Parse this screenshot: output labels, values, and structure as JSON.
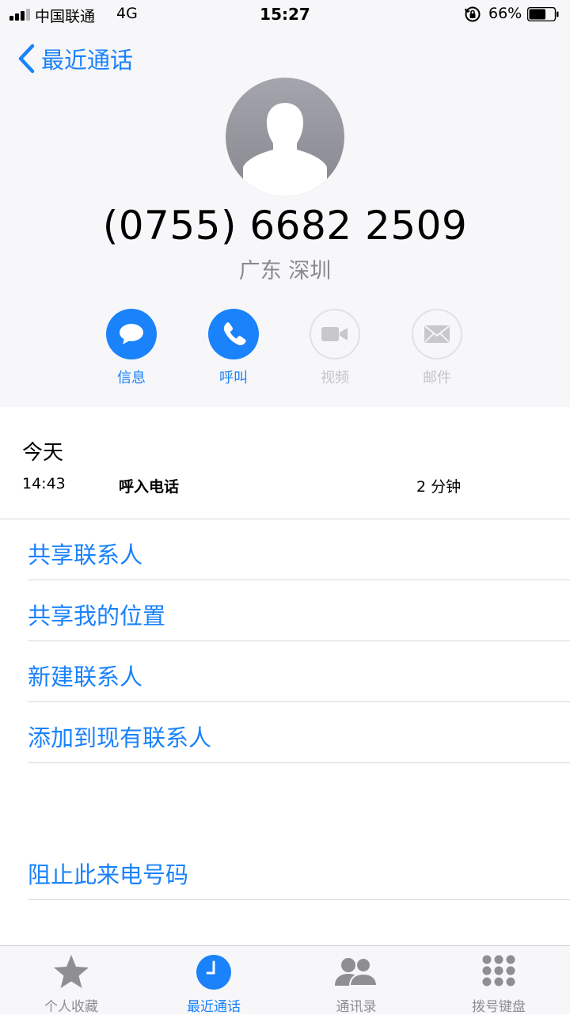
{
  "status_bar": {
    "carrier": "中国联通",
    "network": "4G",
    "time": "15:27",
    "battery_percent": "66%",
    "battery_level": 0.66,
    "signal_bars": 4,
    "signal_active": 3
  },
  "nav": {
    "back_label": "最近通话"
  },
  "contact": {
    "avatar_icon": "person-silhouette-icon",
    "number": "(0755) 6682 2509",
    "location": "广东 深圳"
  },
  "actions": [
    {
      "label": "信息",
      "icon": "message-bubble-icon",
      "enabled": true
    },
    {
      "label": "呼叫",
      "icon": "phone-icon",
      "enabled": true
    },
    {
      "label": "视频",
      "icon": "video-camera-icon",
      "enabled": false
    },
    {
      "label": "邮件",
      "icon": "envelope-icon",
      "enabled": false
    }
  ],
  "history": {
    "title": "今天",
    "entries": [
      {
        "time": "14:43",
        "type": "呼入电话",
        "duration": "2 分钟"
      }
    ]
  },
  "options": [
    "共享联系人",
    "共享我的位置",
    "新建联系人",
    "添加到现有联系人",
    "阻止此来电号码"
  ],
  "tabs": [
    {
      "label": "个人收藏",
      "icon": "star-icon",
      "active": false
    },
    {
      "label": "最近通话",
      "icon": "clock-icon",
      "active": true
    },
    {
      "label": "通讯录",
      "icon": "contacts-icon",
      "active": false
    },
    {
      "label": "拨号键盘",
      "icon": "keypad-icon",
      "active": false
    }
  ],
  "colors": {
    "accent": "#1a82fb",
    "header_background": "#f7f7f9",
    "disabled": "#c4c4c8",
    "inactive_tab": "#8e8e93"
  }
}
